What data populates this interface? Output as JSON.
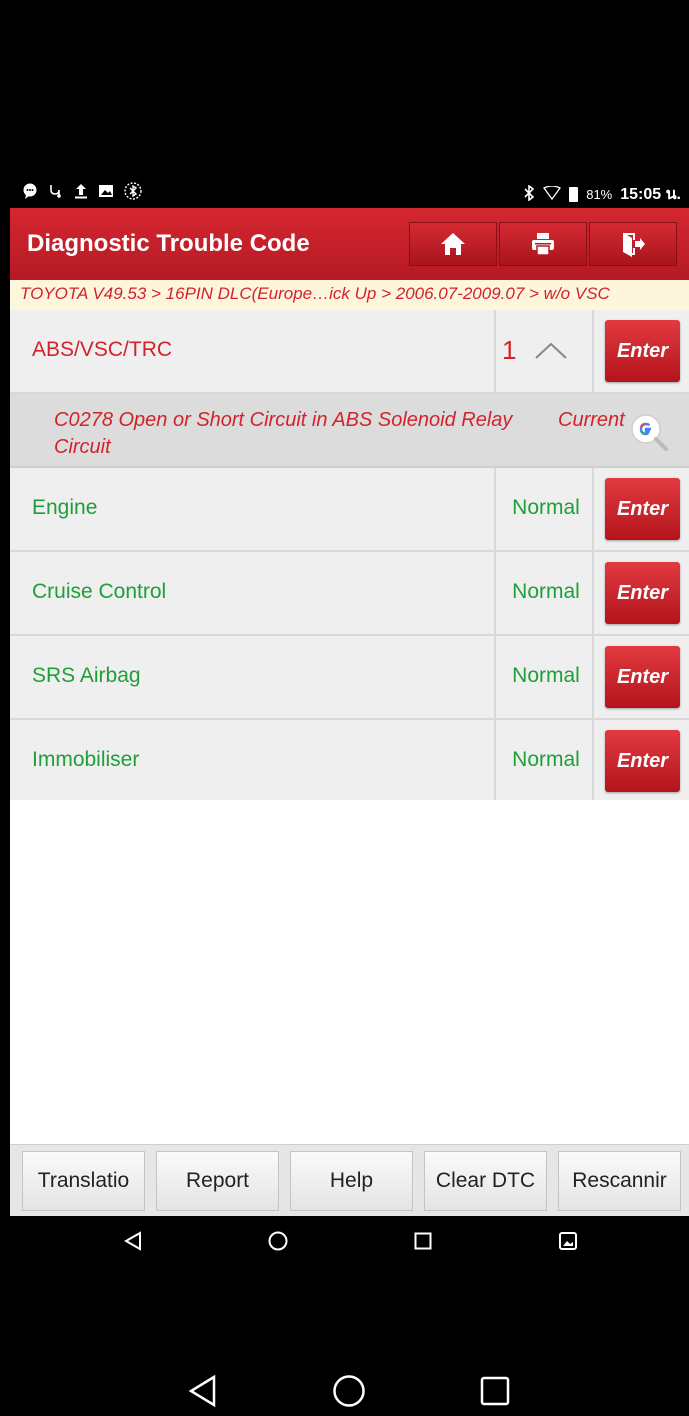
{
  "status_bar": {
    "battery": "81%",
    "time": "15:05 น."
  },
  "header": {
    "title": "Diagnostic Trouble Code",
    "buttons": [
      "home-icon",
      "print-icon",
      "exit-icon"
    ]
  },
  "breadcrumb": "TOYOTA V49.53 > 16PIN DLC(Europe…ick Up > 2006.07-2009.07 > w/o VSC",
  "systems": [
    {
      "name": "ABS/VSC/TRC",
      "count": "1",
      "action": "Enter"
    },
    {
      "name": "Engine",
      "status": "Normal",
      "action": "Enter"
    },
    {
      "name": "Cruise Control",
      "status": "Normal",
      "action": "Enter"
    },
    {
      "name": "SRS Airbag",
      "status": "Normal",
      "action": "Enter"
    },
    {
      "name": "Immobiliser",
      "status": "Normal",
      "action": "Enter"
    }
  ],
  "dtc": {
    "description": "C0278 Open or Short Circuit in ABS Solenoid Relay Circuit",
    "state": "Current"
  },
  "bottom_buttons": [
    "Translatio",
    "Report",
    "Help",
    "Clear DTC",
    "Rescannir"
  ],
  "colors": {
    "header_red": "#c41f29",
    "fault_red": "#d2232c",
    "normal_green": "#1f9e3a"
  }
}
